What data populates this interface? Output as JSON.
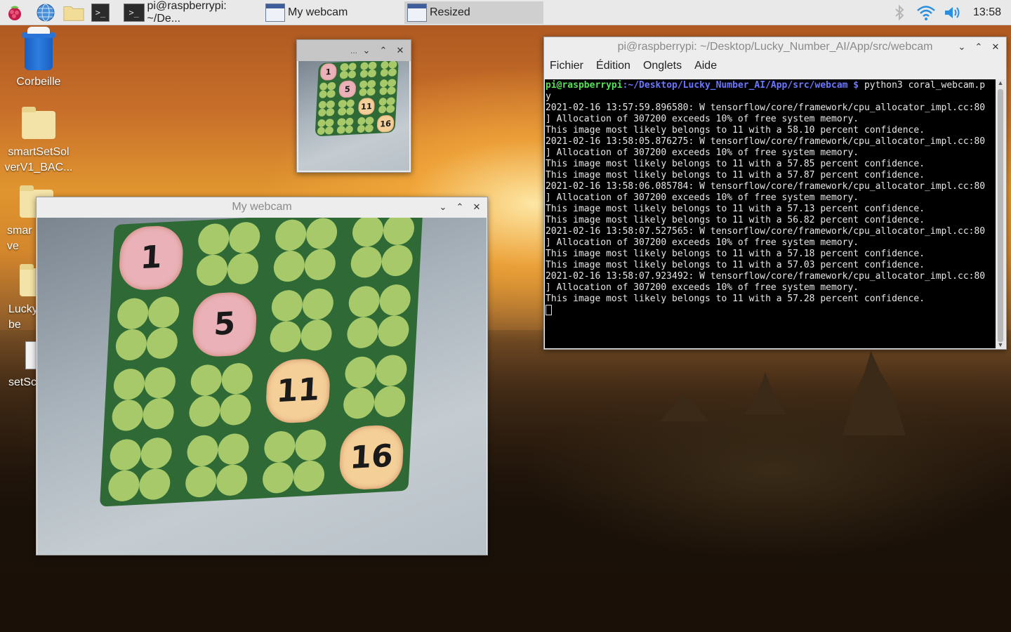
{
  "taskbar": {
    "tasks": [
      {
        "label": "pi@raspberrypi: ~/De..."
      },
      {
        "label": "My webcam"
      },
      {
        "label": "Resized"
      }
    ],
    "clock": "13:58"
  },
  "desktop": {
    "icons": [
      {
        "label": "Corbeille"
      },
      {
        "label": "smartSetSol verV1_BAC..."
      },
      {
        "label": "smar ve"
      },
      {
        "label": "Lucky be"
      },
      {
        "label": "setSc"
      }
    ]
  },
  "resized_window": {
    "title": "...",
    "numbers": [
      "1",
      "5",
      "11",
      "16"
    ]
  },
  "webcam_window": {
    "title": "My webcam",
    "numbers": [
      "1",
      "5",
      "11",
      "16"
    ]
  },
  "terminal": {
    "title": "pi@raspberrypi: ~/Desktop/Lucky_Number_AI/App/src/webcam",
    "menu": [
      "Fichier",
      "Édition",
      "Onglets",
      "Aide"
    ],
    "prompt_user": "pi@raspberrypi",
    "prompt_path": ":~/Desktop/Lucky_Number_AI/App/src/webcam $",
    "command": " python3 coral_webcam.p",
    "lines": [
      "y",
      "2021-02-16 13:57:59.896580: W tensorflow/core/framework/cpu_allocator_impl.cc:80",
      "] Allocation of 307200 exceeds 10% of free system memory.",
      "This image most likely belongs to 11 with a 58.10 percent confidence.",
      "2021-02-16 13:58:05.876275: W tensorflow/core/framework/cpu_allocator_impl.cc:80",
      "] Allocation of 307200 exceeds 10% of free system memory.",
      "This image most likely belongs to 11 with a 57.85 percent confidence.",
      "This image most likely belongs to 11 with a 57.87 percent confidence.",
      "2021-02-16 13:58:06.085784: W tensorflow/core/framework/cpu_allocator_impl.cc:80",
      "] Allocation of 307200 exceeds 10% of free system memory.",
      "This image most likely belongs to 11 with a 57.13 percent confidence.",
      "This image most likely belongs to 11 with a 56.82 percent confidence.",
      "2021-02-16 13:58:07.527565: W tensorflow/core/framework/cpu_allocator_impl.cc:80",
      "] Allocation of 307200 exceeds 10% of free system memory.",
      "This image most likely belongs to 11 with a 57.18 percent confidence.",
      "This image most likely belongs to 11 with a 57.03 percent confidence.",
      "2021-02-16 13:58:07.923492: W tensorflow/core/framework/cpu_allocator_impl.cc:80",
      "] Allocation of 307200 exceeds 10% of free system memory.",
      "This image most likely belongs to 11 with a 57.28 percent confidence."
    ]
  },
  "colors": {
    "prompt_user": "#54e354",
    "prompt_path": "#6b76ff",
    "board_green": "#2f6a36",
    "clover": "#a7c96a",
    "token_pink": "#eab2b8",
    "token_orange": "#f4cf98"
  }
}
